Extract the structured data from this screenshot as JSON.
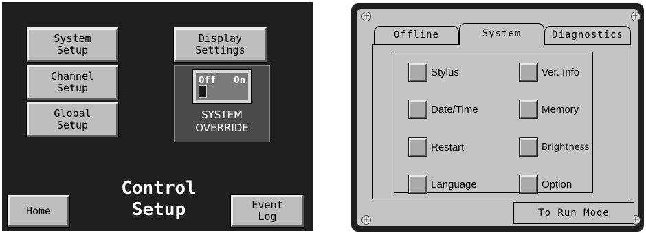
{
  "left_screen": {
    "buttons": {
      "system_setup": [
        "System",
        "Setup"
      ],
      "channel_setup": [
        "Channel",
        "Setup"
      ],
      "global_setup": [
        "Global",
        "Setup"
      ],
      "display_settings": [
        "Display",
        "Settings"
      ],
      "home": "Home",
      "event_log": [
        "Event",
        "Log"
      ]
    },
    "override": {
      "switch_off_label": "Off",
      "switch_on_label": "On",
      "label": [
        "SYSTEM",
        "OVERRIDE"
      ]
    },
    "title": [
      "Control",
      "Setup"
    ]
  },
  "right_screen": {
    "tabs": [
      {
        "label": "Offline",
        "active": false
      },
      {
        "label": "System",
        "active": true
      },
      {
        "label": "Diagnostics",
        "active": false
      }
    ],
    "options": {
      "stylus": "Stylus",
      "date_time": "Date/Time",
      "restart": "Restart",
      "language": "Language",
      "ver_info": "Ver. Info",
      "memory": "Memory",
      "brightness": "Brightness",
      "option": "Option"
    },
    "run_mode_button": "To Run Mode"
  },
  "colors": {
    "panel_background": "#1f1f1f",
    "button_gray": "#bdbdbd",
    "screen_gray": "#c4c4c4",
    "override_box": "#4a4a4a"
  }
}
